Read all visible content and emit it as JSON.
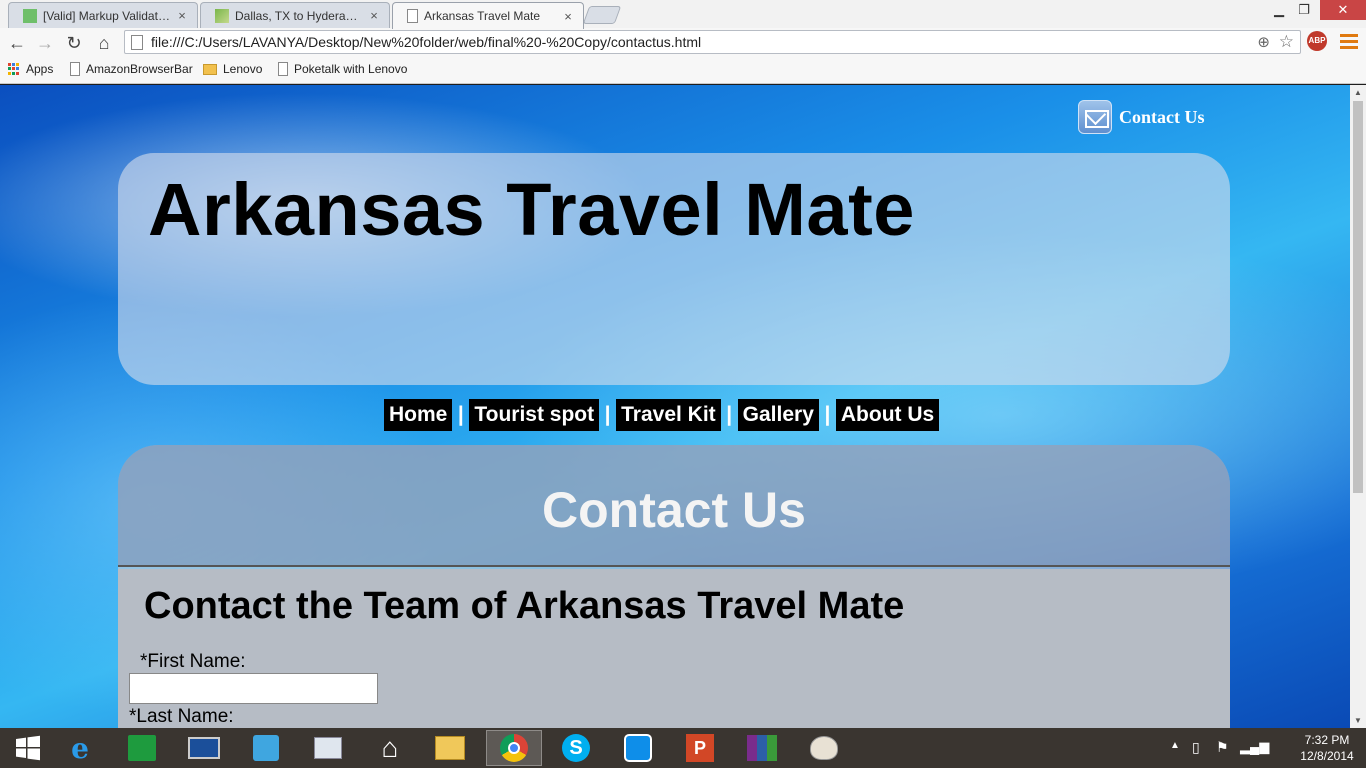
{
  "browser": {
    "tabs": [
      {
        "title": "[Valid] Markup Validation",
        "active": false
      },
      {
        "title": "Dallas, TX to Hyderabad, I",
        "active": false
      },
      {
        "title": "Arkansas Travel Mate",
        "active": true
      }
    ],
    "tab_close_glyph": "×",
    "url": "file:///C:/Users/LAVANYA/Desktop/New%20folder/web/final%20-%20Copy/contactus.html",
    "bookmarks": [
      {
        "label": "Apps",
        "icon": "apps-grid-icon"
      },
      {
        "label": "AmazonBrowserBar",
        "icon": "page-icon"
      },
      {
        "label": "Lenovo",
        "icon": "folder-icon"
      },
      {
        "label": "Poketalk with Lenovo",
        "icon": "page-icon"
      }
    ],
    "extension_label": "ABP"
  },
  "page": {
    "contact_link": "Contact Us",
    "site_title": "Arkansas Travel Mate",
    "nav": [
      "Home",
      "Tourist spot",
      "Travel Kit",
      "Gallery",
      "About Us"
    ],
    "nav_separator": "|",
    "content_heading": "Contact Us",
    "sub_heading": "Contact the Team of Arkansas Travel Mate",
    "form": {
      "first_name_label": "*First Name:",
      "first_name_value": "",
      "last_name_label": "*Last Name:"
    }
  },
  "taskbar": {
    "apps": [
      "windows-start-icon",
      "internet-explorer-icon",
      "store-icon",
      "lenovo-icon",
      "store-bag-icon",
      "performance-monitor-icon",
      "home-icon",
      "file-explorer-icon",
      "chrome-icon",
      "skype-icon",
      "teamviewer-icon",
      "powerpoint-icon",
      "winrar-icon",
      "paint-icon"
    ],
    "time": "7:32 PM",
    "date": "12/8/2014"
  },
  "colors": {
    "page_blue": "#1a8fe8",
    "nav_bg": "#000000",
    "nav_text": "#ffffff",
    "close_button": "#c94545",
    "abp_red": "#c0392b"
  }
}
